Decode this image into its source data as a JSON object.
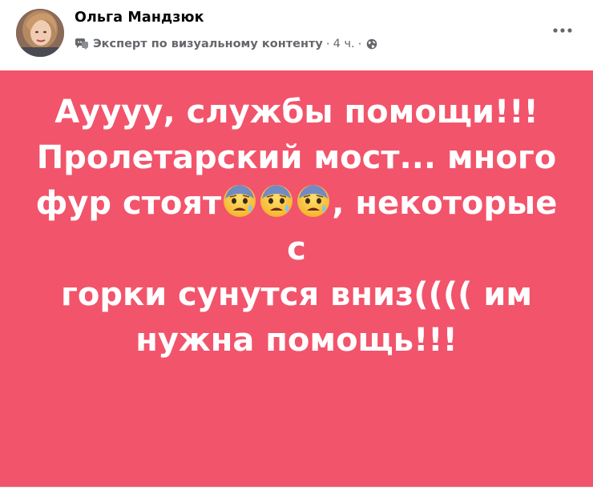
{
  "post": {
    "author": "Ольга Мандзюк",
    "badge": "Эксперт по визуальному контенту",
    "separator": "·",
    "time": "4 ч.",
    "audience_icon": "globe-icon",
    "more_icon": "more-options-icon",
    "background_color": "#f2546b",
    "text_color": "#ffffff",
    "text": {
      "line1": "Ауууу, службы помощи!!!",
      "line2": "Пролетарский мост... много",
      "line3_before": "фур стоят",
      "line3_emojis": [
        "anxious-face-with-sweat",
        "anxious-face-with-sweat",
        "anxious-face-with-sweat"
      ],
      "line3_after": ", некоторые с",
      "line4": "горки сунутся вниз(((( им",
      "line5": "нужна помощь!!!"
    }
  }
}
